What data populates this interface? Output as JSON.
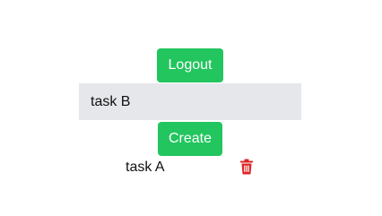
{
  "auth": {
    "logout_label": "Logout"
  },
  "form": {
    "input_value": "task B",
    "create_label": "Create"
  },
  "tasks": [
    {
      "label": "task A",
      "icon": "trash-icon"
    }
  ],
  "colors": {
    "button": "#22c55e",
    "input_bg": "#e5e7eb",
    "delete_icon": "#dc2626"
  }
}
